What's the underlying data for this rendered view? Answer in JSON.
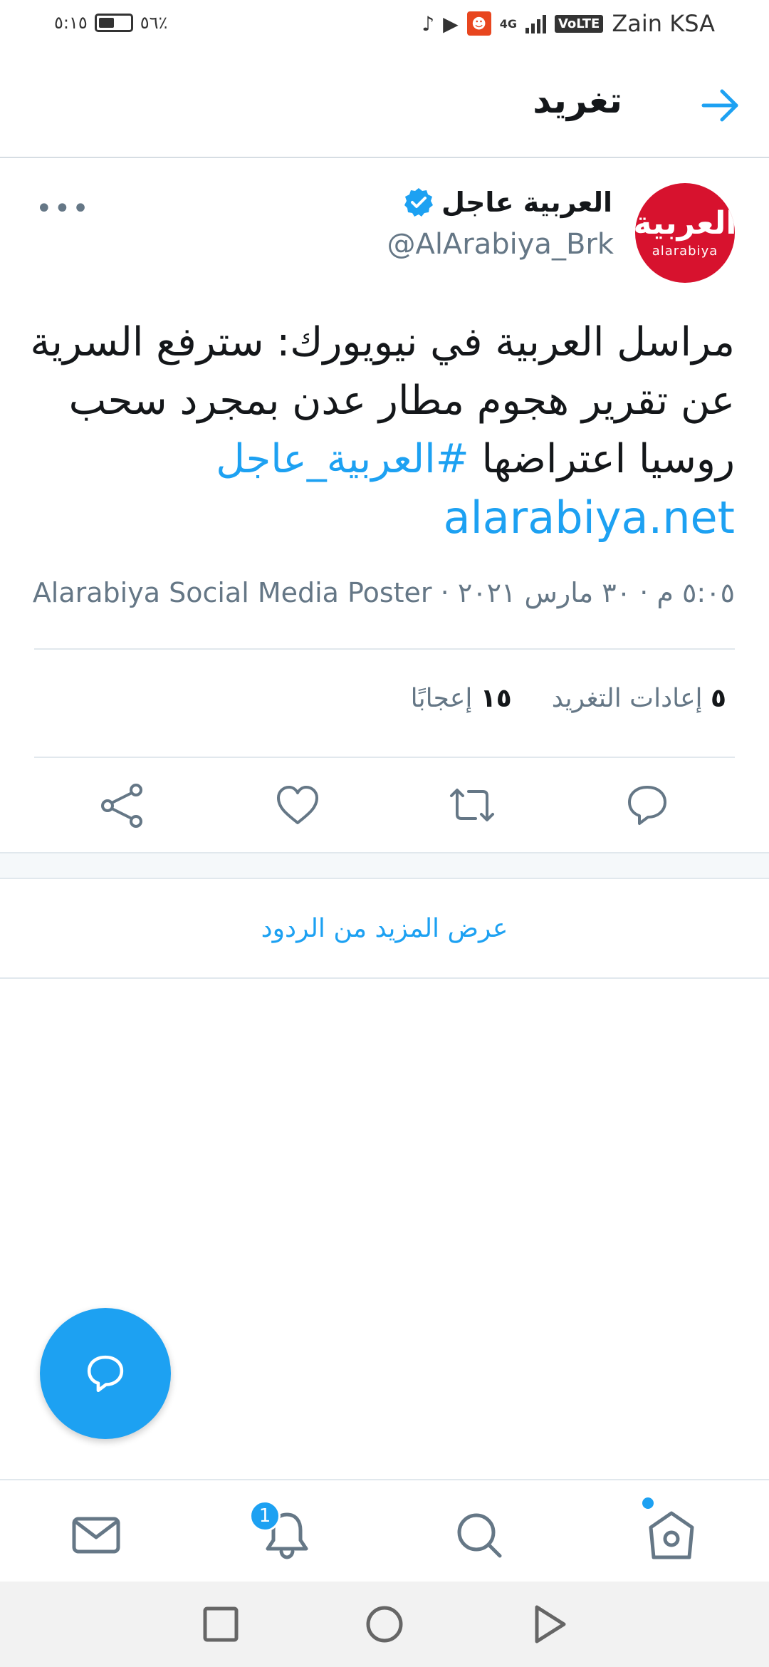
{
  "status_bar": {
    "time": "٥:١٥",
    "battery_percent": "٥٦٪",
    "battery_level": 0.56,
    "carrier": "Zain KSA",
    "volte": "VoLTE",
    "network": "4G"
  },
  "header": {
    "title": "تغريد"
  },
  "tweet": {
    "display_name": "العربية عاجل",
    "handle": "@AlArabiya_Brk",
    "avatar_text_ar": "العربية",
    "avatar_text_en": "alarabiya",
    "body_line1": "مراسل العربية في نيويورك: سترفع السرية",
    "body_line2": "عن تقرير هجوم مطار عدن بمجرد سحب",
    "body_line3": "روسيا اعتراضها",
    "hashtag": "#العربية_عاجل",
    "link": "alarabiya.net",
    "timestamp": "٥:٠٥ م · ٣٠ مارس ٢٠٢١ · ",
    "source": "Alarabiya Social Media Poster",
    "retweets_count": "٥",
    "retweets_label": "إعادات التغريد",
    "likes_count": "١٥",
    "likes_label": "إعجابًا"
  },
  "more_replies_label": "عرض المزيد من الردود",
  "bottom_nav": {
    "notifications_badge": "1"
  },
  "colors": {
    "accent": "#1da1f2",
    "secondary_text": "#657786",
    "avatar_bg": "#d7122e"
  }
}
